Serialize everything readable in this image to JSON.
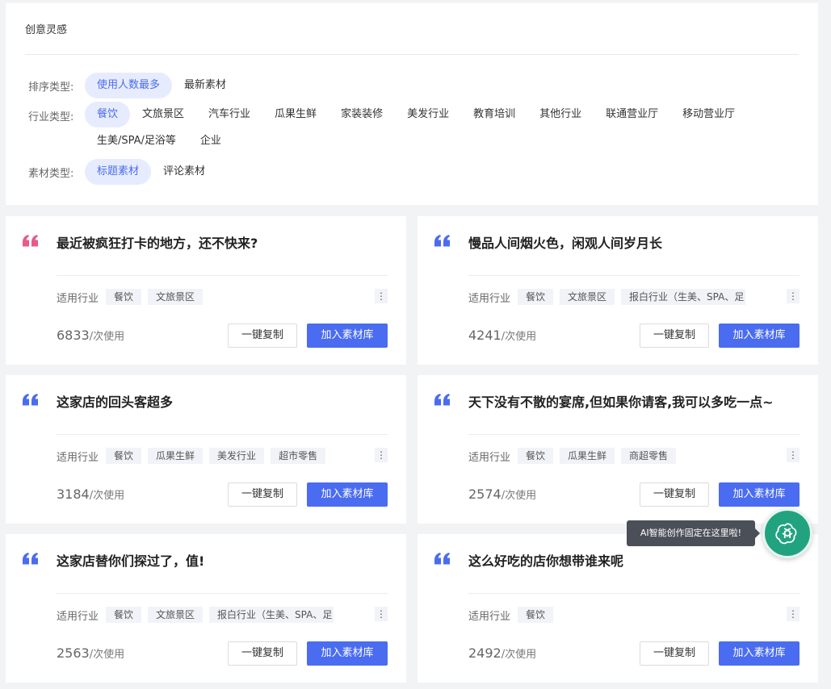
{
  "panel": {
    "title": "创意灵感",
    "sort": {
      "label": "排序类型:",
      "options": [
        "使用人数最多",
        "最新素材"
      ],
      "selected": 0
    },
    "industry": {
      "label": "行业类型:",
      "options": [
        "餐饮",
        "文旅景区",
        "汽车行业",
        "瓜果生鲜",
        "家装装修",
        "美发行业",
        "教育培训",
        "其他行业",
        "联通营业厅",
        "移动营业厅",
        "生美/SPA/足浴等",
        "企业"
      ],
      "selected": 0
    },
    "material": {
      "label": "素材类型:",
      "options": [
        "标题素材",
        "评论素材"
      ],
      "selected": 0
    }
  },
  "card_common": {
    "industry_label": "适用行业",
    "usage_suffix": "/次使用",
    "copy_label": "一键复制",
    "add_label": "加入素材库",
    "more_glyph": "⋮"
  },
  "cards": [
    {
      "title": "最近被疯狂打卡的地方，还不快来?",
      "tags": [
        "餐饮",
        "文旅景区"
      ],
      "usage": "6833",
      "quote_color": "#e85a8c"
    },
    {
      "title": "慢品人间烟火色，闲观人间岁月长",
      "tags": [
        "餐饮",
        "文旅景区",
        "报白行业（生美、SPA、足"
      ],
      "usage": "4241",
      "quote_color": "#4a6cf0"
    },
    {
      "title": "这家店的回头客超多",
      "tags": [
        "餐饮",
        "瓜果生鲜",
        "美发行业",
        "超市零售"
      ],
      "usage": "3184",
      "quote_color": "#4a6cf0"
    },
    {
      "title": "天下没有不散的宴席,但如果你请客,我可以多吃一点~",
      "tags": [
        "餐饮",
        "瓜果生鲜",
        "商超零售"
      ],
      "usage": "2574",
      "quote_color": "#4a6cf0"
    },
    {
      "title": "这家店替你们探过了，值!",
      "tags": [
        "餐饮",
        "文旅景区",
        "报白行业（生美、SPA、足"
      ],
      "usage": "2563",
      "quote_color": "#4a6cf0"
    },
    {
      "title": "这么好吃的店你想带谁来呢",
      "tags": [
        "餐饮"
      ],
      "usage": "2492",
      "quote_color": "#4a6cf0"
    }
  ],
  "ai_assistant": {
    "tooltip": "AI智能创作固定在这里啦!",
    "icon": "openai-icon",
    "color": "#22a37f"
  }
}
